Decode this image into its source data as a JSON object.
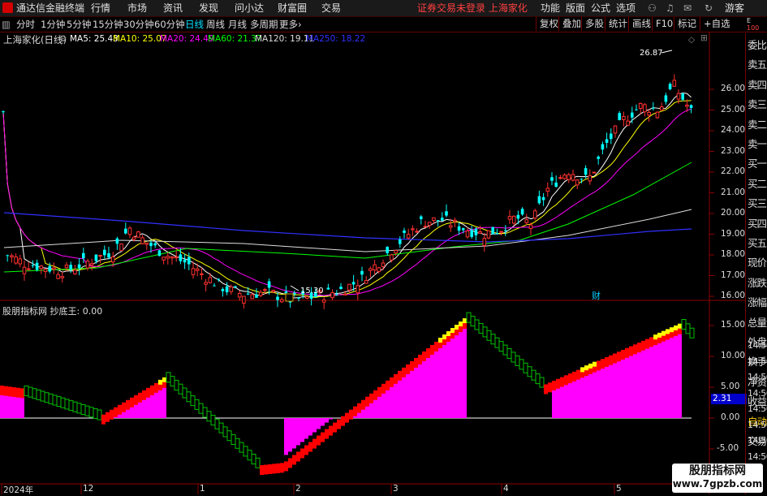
{
  "window": {
    "app_title": "通达信金融终端",
    "menus": [
      "行情",
      "市场",
      "资讯",
      "发现",
      "问小达",
      "财富圈",
      "交易"
    ],
    "status_text": "证券交易未登录  上海家化",
    "right_menus": [
      "功能",
      "版面",
      "公式",
      "选项"
    ],
    "guest": "游客"
  },
  "periods": [
    "分时",
    "1分钟",
    "5分钟",
    "15分钟",
    "30分钟",
    "60分钟",
    "日线",
    "周线",
    "月线",
    "多周期",
    "更多"
  ],
  "active_period": "日线",
  "chart_tools": [
    "复权",
    "叠加",
    "多股",
    "统计",
    "画线",
    "F10",
    "标记",
    "+自选"
  ],
  "stock_label": "上海家化(日线)",
  "ma_legend": [
    {
      "label": "MA5: 25.43",
      "color": "#ffffff"
    },
    {
      "label": "MA10: 25.07",
      "color": "#ffff00"
    },
    {
      "label": "MA20: 24.49",
      "color": "#ff00ff"
    },
    {
      "label": "MA60: 21.37",
      "color": "#00ff00"
    },
    {
      "label": "MA120: 19.11",
      "color": "#dddddd"
    },
    {
      "label": "MA250: 18.22",
      "color": "#3030ff"
    }
  ],
  "price_axis": [
    "26.00",
    "25.00",
    "24.00",
    "23.00",
    "22.00",
    "21.00",
    "20.00",
    "19.00",
    "18.00",
    "17.00",
    "16.00"
  ],
  "price_high_label": "26.87",
  "price_low_label": "15.30",
  "event_label": "财",
  "indicator_label": "股朋指标网  抄底王: 0.00",
  "indicator_axis": [
    "15.00",
    "10.00",
    "5.00",
    "0.00",
    "-5.00"
  ],
  "indicator_value_box": "2.31",
  "side_panel": [
    "委比",
    "卖五",
    "卖四",
    "卖三",
    "卖二",
    "卖一",
    "买一",
    "买二",
    "买三",
    "买四",
    "买五",
    "现价",
    "涨跌",
    "涨幅",
    "总量",
    "外盘",
    "换手",
    "净资",
    "收益",
    "自动",
    "交易"
  ],
  "side_times": [
    "14:56",
    "14:56",
    "14:56",
    "14:56",
    "14:56",
    "14:56",
    "14:56",
    "14:56"
  ],
  "date_axis": [
    "2024年",
    "12",
    "1",
    "2",
    "3",
    "4",
    "5"
  ],
  "watermark_title": "股朋指标网",
  "watermark_url": "www.7gpzb.com",
  "colors": {
    "up": "#ff3030",
    "down": "#00ffff",
    "bar_pos": "#ff00ff",
    "bar_red": "#ff0000",
    "bar_yellow": "#ffff00",
    "bar_green": "#00c000",
    "grid": "#8b0000"
  }
}
